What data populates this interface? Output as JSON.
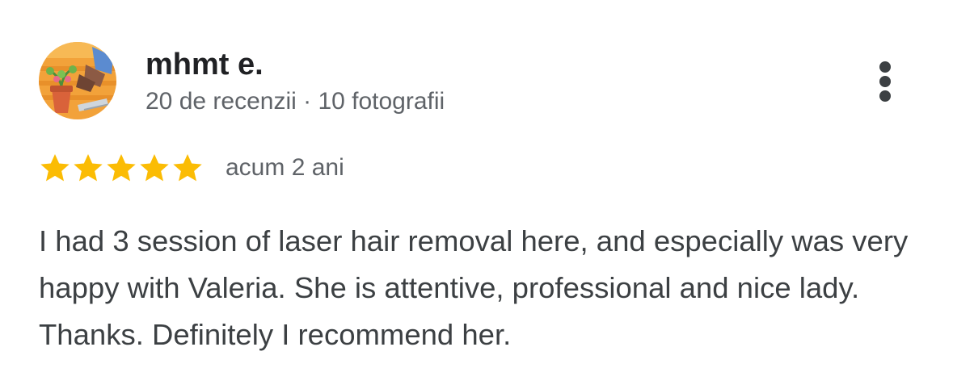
{
  "reviewer": {
    "name": "mhmt e.",
    "meta": "20 de recenzii · 10 fotografii",
    "avatar_icon": "gardening-avatar-icon"
  },
  "rating": {
    "stars": 5,
    "max_stars": 5,
    "star_color": "#fbbc04",
    "date": "acum 2 ani"
  },
  "review": {
    "text": "I had 3 session of laser hair removal here, and especially was very happy with Valeria. She is attentive, professional and nice lady. Thanks. Definitely I recommend her."
  },
  "menu": {
    "icon": "more-vert-icon"
  }
}
